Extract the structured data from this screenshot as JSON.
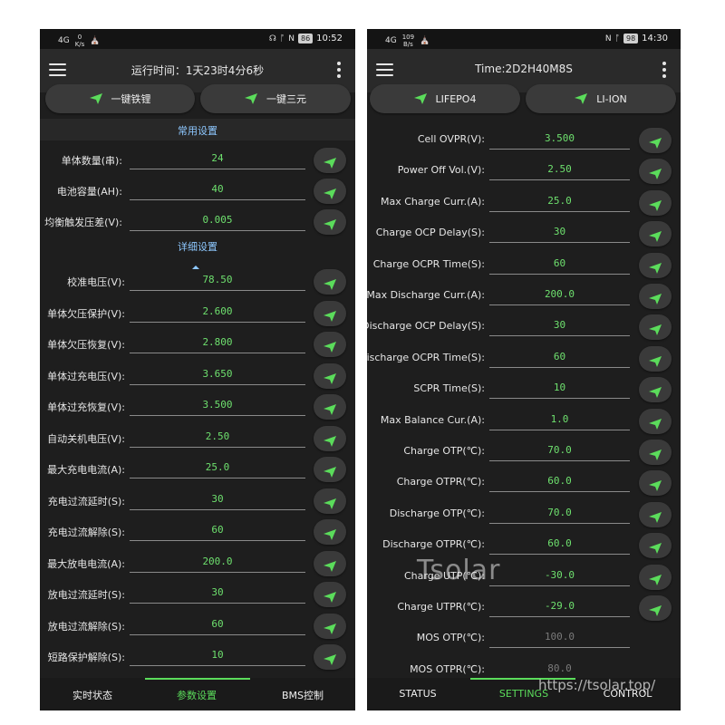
{
  "colors": {
    "accent": "#5bdc5b",
    "value": "#6ee06e",
    "section": "#8ec8ff",
    "background": "#1e1e1e"
  },
  "left": {
    "status": {
      "signal": "4G",
      "speed_value": "0",
      "speed_unit": "K/s",
      "battery": "86",
      "time": "10:52"
    },
    "title": "运行时间：1天23时4分6秒",
    "presets": [
      "一键铁锂",
      "一键三元"
    ],
    "section_common": "常用设置",
    "common_rows": [
      {
        "label": "单体数量(串):",
        "value": "24"
      },
      {
        "label": "电池容量(AH):",
        "value": "40"
      },
      {
        "label": "均衡触发压差(V):",
        "value": "0.005"
      }
    ],
    "section_detail": "详细设置",
    "detail_rows": [
      {
        "label": "校准电压(V):",
        "value": "78.50"
      },
      {
        "label": "单体欠压保护(V):",
        "value": "2.600"
      },
      {
        "label": "单体欠压恢复(V):",
        "value": "2.800"
      },
      {
        "label": "单体过充电压(V):",
        "value": "3.650"
      },
      {
        "label": "单体过充恢复(V):",
        "value": "3.500"
      },
      {
        "label": "自动关机电压(V):",
        "value": "2.50"
      },
      {
        "label": "最大充电电流(A):",
        "value": "25.0"
      },
      {
        "label": "充电过流延时(S):",
        "value": "30"
      },
      {
        "label": "充电过流解除(S):",
        "value": "60"
      },
      {
        "label": "最大放电电流(A):",
        "value": "200.0"
      },
      {
        "label": "放电过流延时(S):",
        "value": "30"
      },
      {
        "label": "放电过流解除(S):",
        "value": "60"
      },
      {
        "label": "短路保护解除(S):",
        "value": "10"
      }
    ],
    "nav": [
      "实时状态",
      "参数设置",
      "BMS控制"
    ]
  },
  "right": {
    "status": {
      "signal": "4G",
      "speed_value": "109",
      "speed_unit": "B/s",
      "battery": "98",
      "time": "14:30"
    },
    "title": "Time:2D2H40M8S",
    "presets": [
      "LIFEPO4",
      "LI-ION"
    ],
    "rows": [
      {
        "label": "Cell OVPR(V):",
        "value": "3.500"
      },
      {
        "label": "Power Off Vol.(V):",
        "value": "2.50"
      },
      {
        "label": "Max Charge Curr.(A):",
        "value": "25.0"
      },
      {
        "label": "Charge OCP Delay(S):",
        "value": "30"
      },
      {
        "label": "Charge OCPR Time(S):",
        "value": "60"
      },
      {
        "label": "Max Discharge Curr.(A):",
        "value": "200.0"
      },
      {
        "label": "Discharge OCP Delay(S):",
        "value": "30"
      },
      {
        "label": "Discharge OCPR Time(S):",
        "value": "60"
      },
      {
        "label": "SCPR Time(S):",
        "value": "10"
      },
      {
        "label": "Max Balance Cur.(A):",
        "value": "1.0"
      },
      {
        "label": "Charge OTP(℃):",
        "value": "70.0"
      },
      {
        "label": "Charge OTPR(℃):",
        "value": "60.0"
      },
      {
        "label": "Discharge OTP(℃):",
        "value": "70.0"
      },
      {
        "label": "Discharge OTPR(℃):",
        "value": "60.0"
      },
      {
        "label": "Charge UTP(℃):",
        "value": "-30.0"
      },
      {
        "label": "Charge UTPR(℃):",
        "value": "-29.0"
      },
      {
        "label": "MOS OTP(℃):",
        "value": "100.0"
      },
      {
        "label": "MOS OTPR(℃):",
        "value": "80.0"
      }
    ],
    "nav": [
      "STATUS",
      "SETTINGS",
      "CONTROL"
    ]
  },
  "watermark": "Tsolar",
  "url": "https://tsolar.top/"
}
